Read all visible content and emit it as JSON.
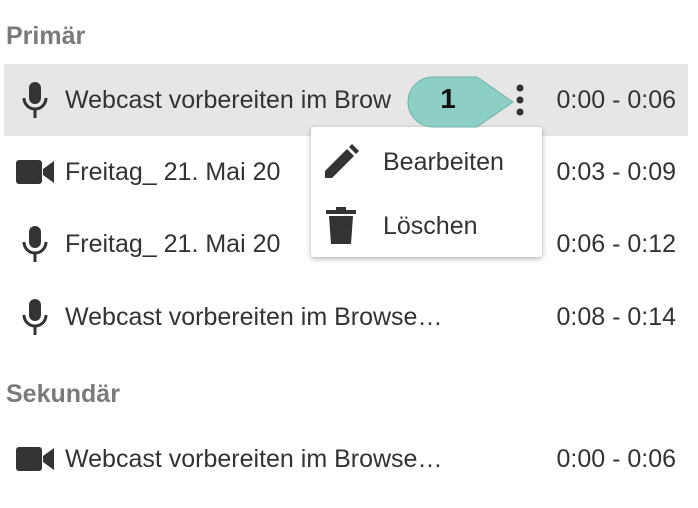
{
  "sections": {
    "primary_title": "Primär",
    "secondary_title": "Sekundär"
  },
  "primary": [
    {
      "icon": "microphone-icon",
      "label": "Webcast vorbereiten im Brow",
      "time": "0:00 - 0:06"
    },
    {
      "icon": "video-camera-icon",
      "label": "Freitag_ 21. Mai 20",
      "time": "0:03 - 0:09"
    },
    {
      "icon": "microphone-icon",
      "label": "Freitag_ 21. Mai 20",
      "time": "0:06 - 0:12"
    },
    {
      "icon": "microphone-icon",
      "label": "Webcast vorbereiten im Browse…",
      "time": "0:08 - 0:14"
    }
  ],
  "secondary": [
    {
      "icon": "video-camera-icon",
      "label": "Webcast vorbereiten im Browse…",
      "time": "0:00 - 0:06"
    }
  ],
  "menu": {
    "edit": {
      "icon": "pencil-icon",
      "label": "Bearbeiten"
    },
    "delete": {
      "icon": "trash-icon",
      "label": "Löschen"
    }
  },
  "callout": {
    "number": "1",
    "color": "#8ecfc5"
  },
  "colors": {
    "selected_row": "#e6e6e6",
    "icon": "#333333",
    "section_title": "#7a7a7a"
  }
}
